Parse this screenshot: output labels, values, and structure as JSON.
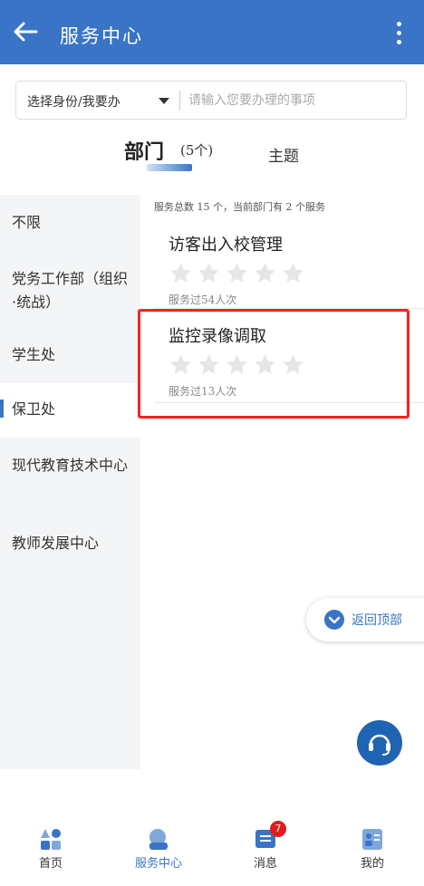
{
  "header": {
    "title": "服务中心"
  },
  "search": {
    "identity_select": "选择身份/我要办",
    "placeholder": "请输入您要办理的事项"
  },
  "tabs": {
    "dept_label": "部门",
    "dept_count": "(5个)",
    "topic_label": "主题"
  },
  "sidebar": {
    "items": [
      {
        "label": "不限"
      },
      {
        "label": "党务工作部（组织·统战）"
      },
      {
        "label": "学生处"
      },
      {
        "label": "保卫处",
        "active": true
      },
      {
        "label": "现代教育技术中心"
      },
      {
        "label": "教师发展中心"
      }
    ]
  },
  "summary": "服务总数 15 个，当前部门有 2 个服务",
  "services": [
    {
      "name": "访客出入校管理",
      "rating": 0,
      "usage": "服务过54人次"
    },
    {
      "name": "监控录像调取",
      "rating": 0,
      "usage": "服务过13人次"
    }
  ],
  "back_to_top": "返回顶部",
  "bottom_nav": {
    "items": [
      {
        "label": "首页"
      },
      {
        "label": "服务中心",
        "active": true
      },
      {
        "label": "消息",
        "badge": "7"
      },
      {
        "label": "我的"
      }
    ]
  },
  "colors": {
    "primary": "#3a74c6",
    "highlight": "#ff1f1f",
    "badge": "#e41b1b"
  }
}
